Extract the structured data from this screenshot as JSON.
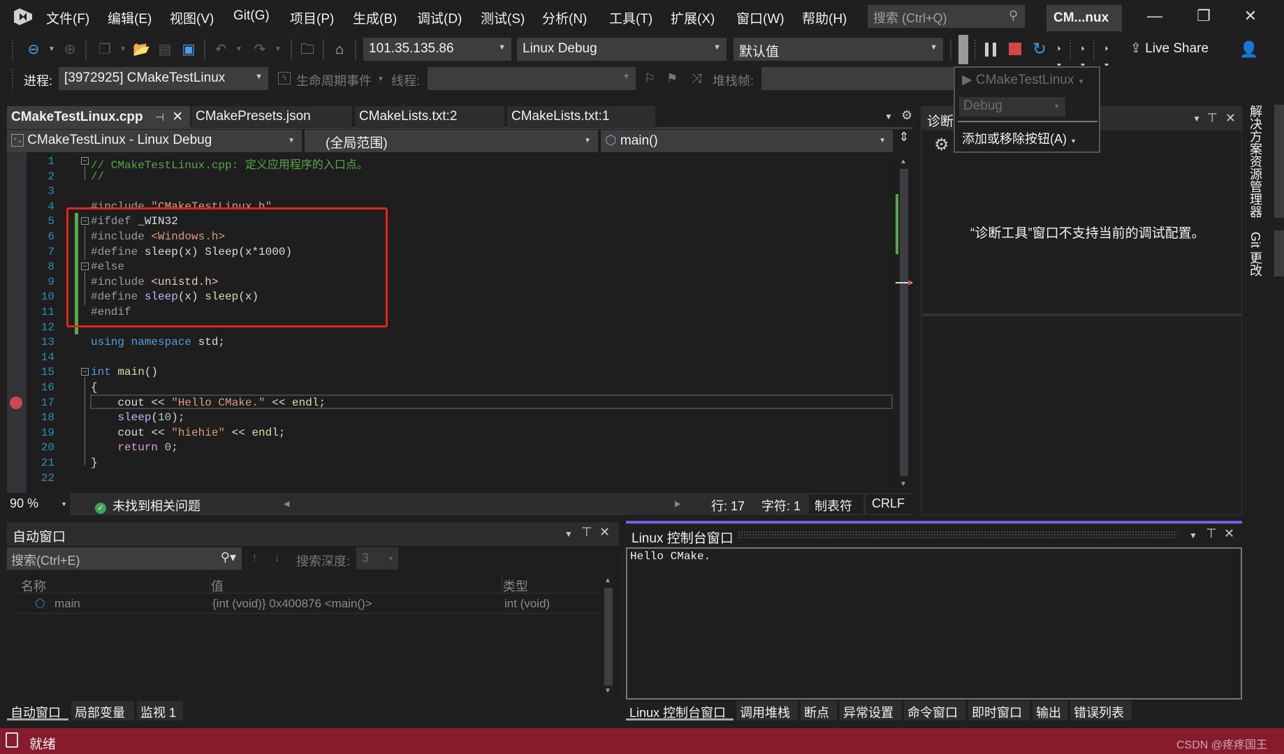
{
  "titlebar": {
    "menus": [
      "文件(F)",
      "编辑(E)",
      "视图(V)",
      "Git(G)",
      "项目(P)",
      "生成(B)",
      "调试(D)",
      "测试(S)",
      "分析(N)",
      "工具(T)",
      "扩展(X)",
      "窗口(W)",
      "帮助(H)"
    ],
    "search_placeholder": "搜索 (Ctrl+Q)",
    "project_badge": "CM...nux",
    "minimize": "—",
    "restore": "❐",
    "close": "✕"
  },
  "toolbar": {
    "target_machine": "101.35.135.86",
    "configuration": "Linux Debug",
    "preset": "默认值",
    "live_share": "Live Share"
  },
  "debug_location": {
    "process_label": "进程:",
    "process_value": "[3972925] CMakeTestLinux",
    "lifecycle_label": "生命周期事件",
    "thread_label": "线程:",
    "thread_value": "",
    "stackframe_label": "堆栈帧:",
    "stackframe_value": ""
  },
  "popup": {
    "startup_item": "CMakeTestLinux",
    "config": "Debug",
    "add_remove": "添加或移除按钮(A)"
  },
  "doc_tabs": [
    {
      "label": "CMakeTestLinux.cpp",
      "active": true
    },
    {
      "label": "CMakePresets.json",
      "active": false
    },
    {
      "label": "CMakeLists.txt:2",
      "active": false
    },
    {
      "label": "CMakeLists.txt:1",
      "active": false
    }
  ],
  "navbar": {
    "project": "CMakeTestLinux - Linux Debug",
    "scope": "(全局范围)",
    "member": "main()"
  },
  "editor": {
    "lines": [
      {
        "n": "1",
        "segs": [
          [
            "c-comment",
            "// CMakeTestLinux.cpp: 定义应用程序的入口点。"
          ]
        ]
      },
      {
        "n": "2",
        "segs": [
          [
            "c-comment",
            "//"
          ]
        ]
      },
      {
        "n": "3",
        "segs": []
      },
      {
        "n": "4",
        "segs": [
          [
            "c-pre",
            "#include "
          ],
          [
            "c-str",
            "\"CMakeTestLinux.h\""
          ]
        ]
      },
      {
        "n": "5",
        "segs": [
          [
            "c-pre",
            "#ifdef "
          ],
          [
            "c-plain",
            "_WIN32"
          ]
        ]
      },
      {
        "n": "6",
        "segs": [
          [
            "c-pre",
            "#include "
          ],
          [
            "c-str",
            "<Windows.h>"
          ]
        ]
      },
      {
        "n": "7",
        "segs": [
          [
            "c-pre",
            "#define "
          ],
          [
            "c-plain",
            "sleep(x) Sleep(x*1000)"
          ]
        ]
      },
      {
        "n": "8",
        "segs": [
          [
            "c-pre",
            "#else"
          ]
        ]
      },
      {
        "n": "9",
        "segs": [
          [
            "c-pre",
            "#include "
          ],
          [
            "c-inc",
            "<unistd.h>"
          ]
        ]
      },
      {
        "n": "10",
        "segs": [
          [
            "c-pre",
            "#define "
          ],
          [
            "c-macro",
            "sleep"
          ],
          [
            "c-plain",
            "(x) "
          ],
          [
            "c-fn",
            "sleep"
          ],
          [
            "c-plain",
            "(x)"
          ]
        ]
      },
      {
        "n": "11",
        "segs": [
          [
            "c-pre",
            "#endif"
          ]
        ]
      },
      {
        "n": "12",
        "segs": []
      },
      {
        "n": "13",
        "segs": [
          [
            "c-kw",
            "using namespace "
          ],
          [
            "c-plain",
            "std;"
          ]
        ]
      },
      {
        "n": "14",
        "segs": []
      },
      {
        "n": "15",
        "segs": [
          [
            "c-kw",
            "int "
          ],
          [
            "c-fn",
            "main"
          ],
          [
            "c-plain",
            "()"
          ]
        ]
      },
      {
        "n": "16",
        "segs": [
          [
            "c-plain",
            "{"
          ]
        ]
      },
      {
        "n": "17",
        "segs": [
          [
            "c-plain",
            "    cout << "
          ],
          [
            "c-str",
            "\"Hello CMake.\""
          ],
          [
            "c-plain",
            " << "
          ],
          [
            "c-fn",
            "endl"
          ],
          [
            "c-plain",
            ";"
          ]
        ]
      },
      {
        "n": "18",
        "segs": [
          [
            "c-plain",
            "    "
          ],
          [
            "c-macro",
            "sleep"
          ],
          [
            "c-plain",
            "("
          ],
          [
            "c-num",
            "10"
          ],
          [
            "c-plain",
            ");"
          ]
        ]
      },
      {
        "n": "19",
        "segs": [
          [
            "c-plain",
            "    cout << "
          ],
          [
            "c-str",
            "\"hiehie\""
          ],
          [
            "c-plain",
            " << "
          ],
          [
            "c-fn",
            "endl"
          ],
          [
            "c-plain",
            ";"
          ]
        ]
      },
      {
        "n": "20",
        "segs": [
          [
            "c-plain",
            "    "
          ],
          [
            "c-ret",
            "return "
          ],
          [
            "c-num",
            "0"
          ],
          [
            "c-plain",
            ";"
          ]
        ]
      },
      {
        "n": "21",
        "segs": [
          [
            "c-plain",
            "}"
          ]
        ]
      },
      {
        "n": "22",
        "segs": []
      }
    ],
    "breakpoint_line": 17
  },
  "editor_status": {
    "zoom": "90 %",
    "issues": "未找到相关问题",
    "line": "行: 17",
    "char": "字符: 1",
    "tabs": "制表符",
    "eol": "CRLF"
  },
  "diagnostics": {
    "title": "诊断",
    "message": "“诊断工具”窗口不支持当前的调试配置。"
  },
  "side_tabs": [
    "解决方案资源管理器",
    "Git 更改"
  ],
  "autos": {
    "title": "自动窗口",
    "search_placeholder": "搜索(Ctrl+E)",
    "depth_label": "搜索深度:",
    "depth_value": "3",
    "columns": [
      "名称",
      "值",
      "类型"
    ],
    "rows": [
      {
        "name": "main",
        "value": "{int (void)} 0x400876 <main()>",
        "type": "int (void)"
      }
    ]
  },
  "left_bottom_tabs": [
    {
      "label": "自动窗口",
      "active": true
    },
    {
      "label": "局部变量",
      "active": false
    },
    {
      "label": "监视 1",
      "active": false
    }
  ],
  "console": {
    "title": "Linux 控制台窗口",
    "output": "Hello CMake."
  },
  "right_bottom_tabs": [
    {
      "label": "Linux 控制台窗口",
      "active": true
    },
    {
      "label": "调用堆栈",
      "active": false
    },
    {
      "label": "断点",
      "active": false
    },
    {
      "label": "异常设置",
      "active": false
    },
    {
      "label": "命令窗口",
      "active": false
    },
    {
      "label": "即时窗口",
      "active": false
    },
    {
      "label": "输出",
      "active": false
    },
    {
      "label": "错误列表",
      "active": false
    }
  ],
  "statusbar": {
    "text": "就绪",
    "watermark": "CSDN @疼疼国王"
  },
  "colors": {
    "statusbar": "#861b2d",
    "accent": "#7160e8",
    "breakpoint": "#c84b50",
    "highlight_box": "#e8221c"
  }
}
